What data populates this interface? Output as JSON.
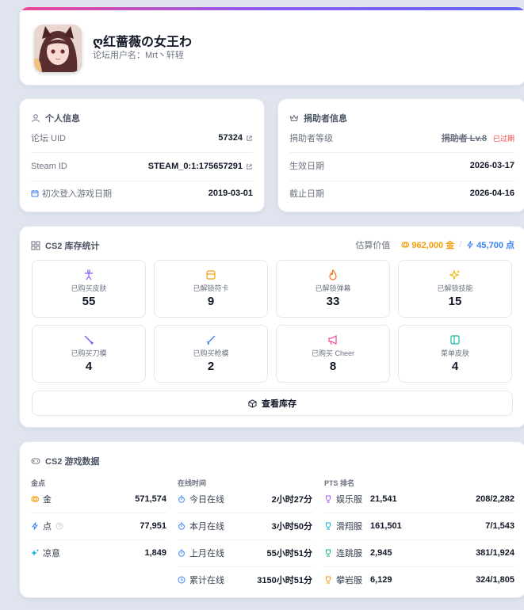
{
  "profile": {
    "nickname": "ღ红蔷薇の女王わ",
    "forum_username": "论坛用户名：Mrt丶轩轾"
  },
  "personal": {
    "title": "个人信息",
    "uid_label": "论坛 UID",
    "uid_value": "57324",
    "steam_label": "Steam ID",
    "steam_value": "STEAM_0:1:175657291",
    "first_login_label": "初次登入游戏日期",
    "first_login_value": "2019-03-01"
  },
  "donor": {
    "title": "捐助者信息",
    "level_label": "捐助者等级",
    "level_value": "捐助者 Lv.8",
    "expired_tag": "已过期",
    "effective_label": "生效日期",
    "effective_value": "2026-03-17",
    "expire_label": "截止日期",
    "expire_value": "2026-04-16"
  },
  "inventory": {
    "title": "CS2 库存统计",
    "estimate_label": "估算价值",
    "gold_value": "962,000 金",
    "points_value": "45,700 点",
    "tiles": [
      {
        "label": "已购买皮肤",
        "value": "55",
        "icon": "figure-icon",
        "color": "#8b5cf6"
      },
      {
        "label": "已解锁符卡",
        "value": "9",
        "icon": "card-icon",
        "color": "#f59e0b"
      },
      {
        "label": "已解锁弹幕",
        "value": "33",
        "icon": "flame-icon",
        "color": "#f97316"
      },
      {
        "label": "已解锁技能",
        "value": "15",
        "icon": "sparkles-icon",
        "color": "#eab308"
      },
      {
        "label": "已购买刀模",
        "value": "4",
        "icon": "knife-icon",
        "color": "#6366f1"
      },
      {
        "label": "已购买枪模",
        "value": "2",
        "icon": "gun-icon",
        "color": "#3b82f6"
      },
      {
        "label": "已购买 Cheer",
        "value": "8",
        "icon": "megaphone-icon",
        "color": "#ec4899"
      },
      {
        "label": "菜单皮肤",
        "value": "4",
        "icon": "panel-icon",
        "color": "#14b8a6"
      }
    ],
    "view_button": "查看库存"
  },
  "game": {
    "title": "CS2 游戏数据",
    "currency_head": "金点",
    "gold_label": "金",
    "gold_value": "571,574",
    "point_label": "点",
    "point_value": "77,951",
    "cool_label": "凉意",
    "cool_value": "1,849",
    "online_head": "在线时间",
    "today_label": "今日在线",
    "today_value": "2小时27分",
    "month_label": "本月在线",
    "month_value": "3小时50分",
    "lastmonth_label": "上月在线",
    "lastmonth_value": "55小时51分",
    "total_label": "累计在线",
    "total_value": "3150小时51分",
    "pts_head": "PTS 排名",
    "pts": [
      {
        "server": "娱乐服",
        "score": "21,541",
        "rank": "208/2,282",
        "color": "#a855f7"
      },
      {
        "server": "滑翔服",
        "score": "161,501",
        "rank": "7/1,543",
        "color": "#06b6d4"
      },
      {
        "server": "连跳服",
        "score": "2,945",
        "rank": "381/1,924",
        "color": "#10b981"
      },
      {
        "server": "攀岩服",
        "score": "6,129",
        "rank": "324/1,805",
        "color": "#f59e0b"
      }
    ]
  }
}
